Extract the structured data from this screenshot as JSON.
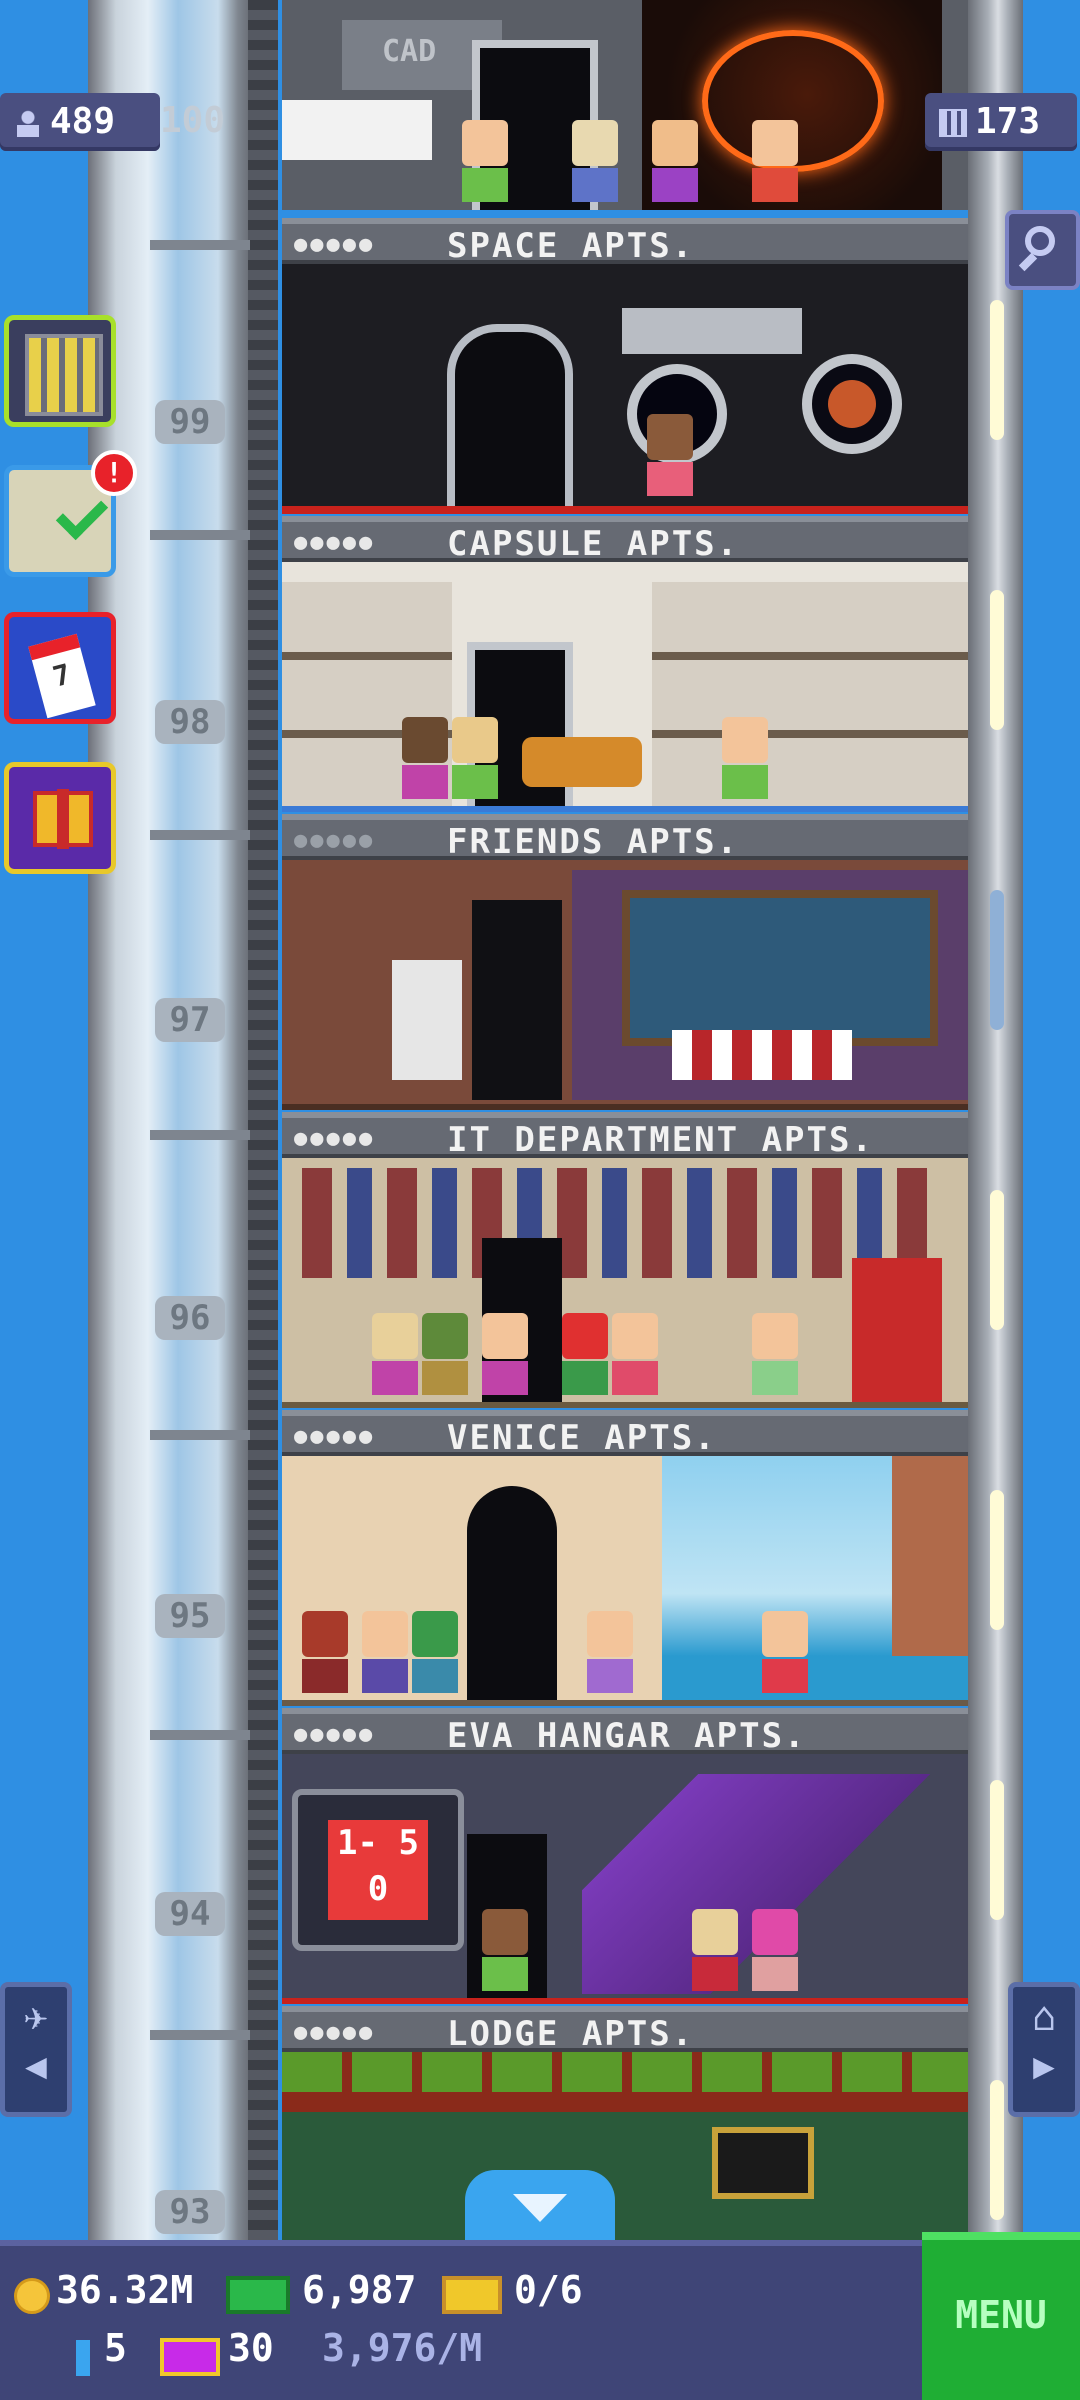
{
  "hud": {
    "population": "489",
    "population_cap": "100",
    "floors": "173"
  },
  "shaft": {
    "floor_numbers": [
      "99",
      "98",
      "97",
      "96",
      "95",
      "94",
      "93"
    ]
  },
  "floors": [
    {
      "label": "SPACE APTS."
    },
    {
      "label": "CAPSULE APTS."
    },
    {
      "label": "FRIENDS APTS."
    },
    {
      "label": "IT DEPARTMENT APTS."
    },
    {
      "label": "VENICE APTS."
    },
    {
      "label": "EVA HANGAR APTS."
    },
    {
      "label": "LODGE APTS."
    }
  ],
  "floor_label_dots": "●●●●●",
  "top_floor": {
    "sign": "CAD"
  },
  "eva_display": "1- 50",
  "sidebar": {
    "badge": "!",
    "calendar_day": "7"
  },
  "bottom": {
    "coins": "36.32M",
    "bux": "6,987",
    "tickets": "0/6",
    "elevator_upgrades": "5",
    "vip": "30",
    "income_rate": "3,976/M",
    "menu_label": "MENU"
  },
  "colors": {
    "sky": "#2f8fe3",
    "hud_pill": "#4a4f80",
    "menu_green": "#1fae34",
    "label_bar": "#666a73"
  },
  "icons": {
    "population": "person-icon",
    "floors": "building-icon",
    "search": "magnifier-icon",
    "coins": "coin-icon",
    "bux": "cash-icon",
    "tickets": "ticket-icon",
    "vip": "vip-icon"
  }
}
